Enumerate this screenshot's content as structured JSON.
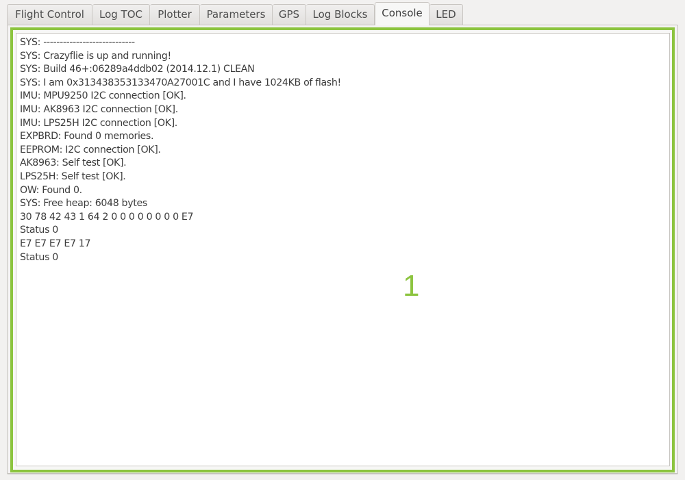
{
  "tabs": [
    {
      "label": "Flight Control",
      "active": false
    },
    {
      "label": "Log TOC",
      "active": false
    },
    {
      "label": "Plotter",
      "active": false
    },
    {
      "label": "Parameters",
      "active": false
    },
    {
      "label": "GPS",
      "active": false
    },
    {
      "label": "Log Blocks",
      "active": false
    },
    {
      "label": "Console",
      "active": true
    },
    {
      "label": "LED",
      "active": false
    }
  ],
  "console": {
    "lines": [
      "SYS: ----------------------------",
      "SYS: Crazyflie is up and running!",
      "SYS: Build 46+:06289a4ddb02 (2014.12.1) CLEAN",
      "SYS: I am 0x313438353133470A27001C and I have 1024KB of flash!",
      "IMU: MPU9250 I2C connection [OK].",
      "IMU: AK8963 I2C connection [OK].",
      "IMU: LPS25H I2C connection [OK].",
      "EXPBRD: Found 0 memories.",
      "EEPROM: I2C connection [OK].",
      "AK8963: Self test [OK].",
      "LPS25H: Self test [OK].",
      "OW: Found 0.",
      "SYS: Free heap: 6048 bytes",
      "30 78 42 43 1 64 2 0 0 0 0 0 0 0 0 E7",
      "Status 0",
      "E7 E7 E7 E7 17",
      "Status 0"
    ]
  },
  "annotation": {
    "label": "1",
    "color": "#8cc43f"
  }
}
